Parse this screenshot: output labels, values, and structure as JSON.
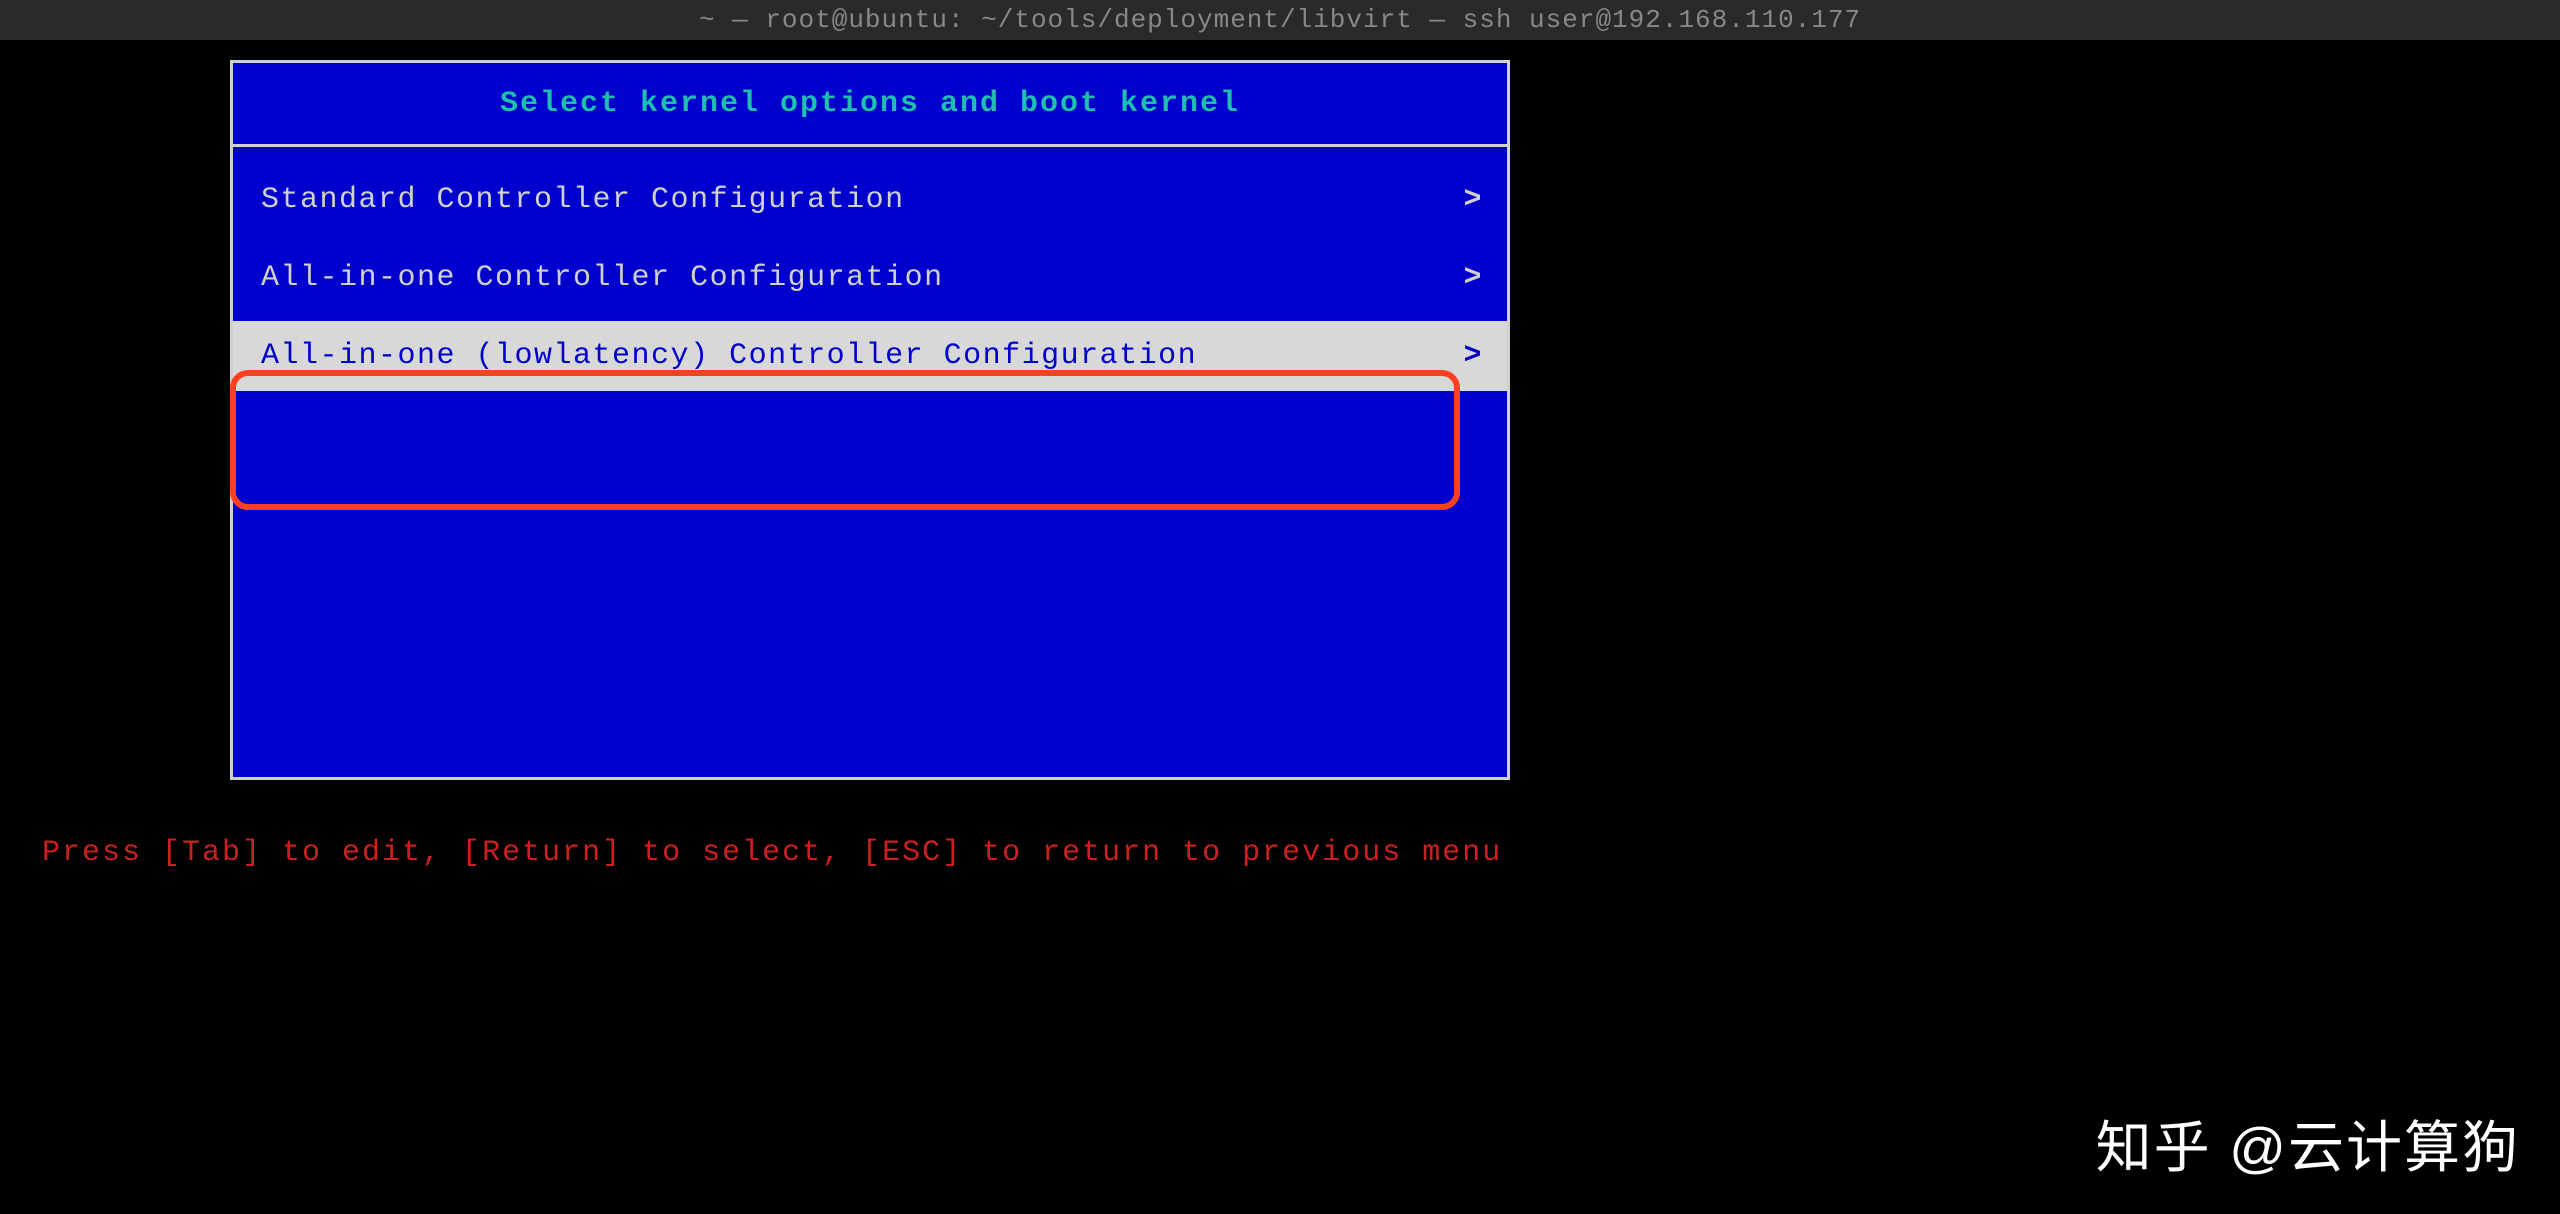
{
  "titlebar": "~ — root@ubuntu: ~/tools/deployment/libvirt — ssh user@192.168.110.177",
  "menu": {
    "title": "Select kernel options and boot kernel",
    "items": [
      {
        "label": "Standard Controller Configuration",
        "chevron": ">",
        "selected": false
      },
      {
        "label": "All-in-one Controller Configuration",
        "chevron": ">",
        "selected": false
      },
      {
        "label": "All-in-one (lowlatency) Controller Configuration",
        "chevron": ">",
        "selected": true
      }
    ]
  },
  "hint": "Press [Tab] to edit, [Return] to select, [ESC] to return to previous menu",
  "watermark": "知乎 @云计算狗"
}
